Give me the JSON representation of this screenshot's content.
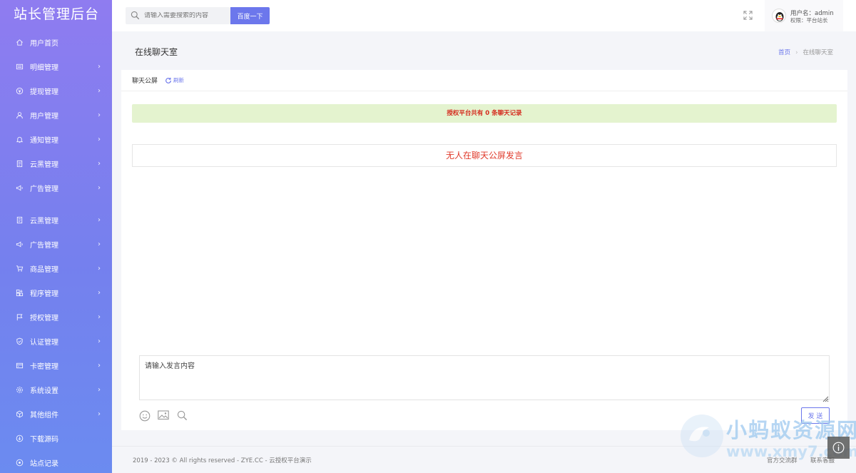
{
  "sidebar": {
    "brand": "站长管理后台",
    "items": [
      {
        "label": "用户首页",
        "icon": "home-icon",
        "chevron": false
      },
      {
        "label": "明细管理",
        "icon": "list-icon",
        "chevron": true
      },
      {
        "label": "提现管理",
        "icon": "coin-icon",
        "chevron": true
      },
      {
        "label": "用户管理",
        "icon": "user-icon",
        "chevron": true
      },
      {
        "label": "通知管理",
        "icon": "bell-icon",
        "chevron": true
      },
      {
        "label": "云黑管理",
        "icon": "document-icon",
        "chevron": true
      },
      {
        "label": "广告管理",
        "icon": "megaphone-icon",
        "chevron": true
      },
      {
        "label": "云黑管理",
        "icon": "document-icon",
        "chevron": true
      },
      {
        "label": "广告管理",
        "icon": "megaphone-icon",
        "chevron": true
      },
      {
        "label": "商品管理",
        "icon": "cart-icon",
        "chevron": true
      },
      {
        "label": "程序管理",
        "icon": "apps-icon",
        "chevron": true
      },
      {
        "label": "授权管理",
        "icon": "flag-icon",
        "chevron": true
      },
      {
        "label": "认证管理",
        "icon": "shield-icon",
        "chevron": true
      },
      {
        "label": "卡密管理",
        "icon": "card-icon",
        "chevron": true
      },
      {
        "label": "系统设置",
        "icon": "gear-icon",
        "chevron": true
      },
      {
        "label": "其他组件",
        "icon": "cube-icon",
        "chevron": true
      },
      {
        "label": "下载源码",
        "icon": "download-icon",
        "chevron": false
      },
      {
        "label": "站点记录",
        "icon": "record-icon",
        "chevron": false
      }
    ]
  },
  "header": {
    "search_placeholder": "请输入需要搜索的内容",
    "search_button": "百度一下",
    "user_name": "用户名：admin",
    "user_role": "权限：平台站长"
  },
  "page": {
    "title": "在线聊天室",
    "breadcrumb_home": "首页",
    "breadcrumb_sep": "›",
    "breadcrumb_current": "在线聊天室"
  },
  "chat": {
    "panel_title": "聊天公屏",
    "refresh_label": "刷新",
    "notice": "授权平台共有 0 条聊天记录",
    "empty_message": "无人在聊天公屏发言",
    "input_placeholder": "请输入发言内容",
    "send_button": "发 送"
  },
  "footer": {
    "copyright": "2019 - 2023 © All rights reserved - ZYE.CC - 云授权平台演示",
    "link_group": "官方交流群",
    "link_support": "联系客服"
  },
  "watermark": {
    "title": "小蚂蚁资源网",
    "url": "www.xmy7.com"
  },
  "colors": {
    "accent": "#6c77ec",
    "sidebar_top": "#8f7cf0",
    "sidebar_bottom": "#6b8bf0",
    "notice_bg": "#e4f3cf",
    "alert_text": "#e03a2b"
  }
}
